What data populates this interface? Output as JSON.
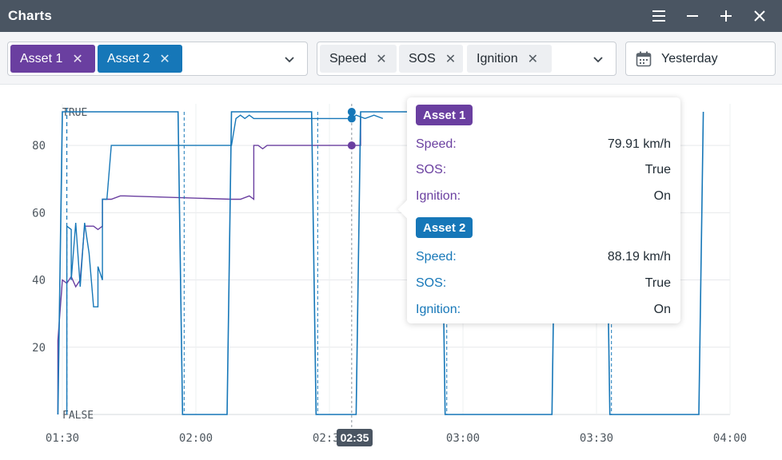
{
  "window": {
    "title": "Charts"
  },
  "toolbar": {
    "assets": [
      {
        "label": "Asset 1",
        "color": "#6a3fa0"
      },
      {
        "label": "Asset 2",
        "color": "#1677b8"
      }
    ],
    "metrics": [
      {
        "label": "Speed"
      },
      {
        "label": "SOS"
      },
      {
        "label": "Ignition"
      }
    ],
    "date_range": "Yesterday"
  },
  "chart_data": {
    "type": "line",
    "x_ticks": [
      "01:30",
      "02:00",
      "02:30",
      "03:00",
      "03:30",
      "04:00"
    ],
    "y_ticks": [
      "20",
      "40",
      "60",
      "80"
    ],
    "boolean_labels": {
      "true": "TRUE",
      "false": "FALSE"
    },
    "cursor_time": "02:35",
    "ylim": [
      0,
      90
    ],
    "grid": true,
    "series": [
      {
        "name": "Asset 1",
        "color": "#6a3fa0",
        "speed": [
          [
            "01:29",
            0
          ],
          [
            "01:29",
            22
          ],
          [
            "01:30",
            40
          ],
          [
            "01:31",
            39
          ],
          [
            "01:32",
            41
          ],
          [
            "01:33",
            38
          ],
          [
            "01:34",
            40
          ],
          [
            "01:35",
            56
          ],
          [
            "01:37",
            56
          ],
          [
            "01:38",
            55
          ],
          [
            "01:39",
            56
          ],
          [
            "01:39",
            64
          ],
          [
            "01:41",
            64
          ],
          [
            "01:43",
            65
          ],
          [
            "01:44",
            65
          ],
          [
            "02:08",
            64
          ],
          [
            "02:10",
            64
          ],
          [
            "02:12",
            65
          ],
          [
            "02:13",
            64
          ],
          [
            "02:13",
            80
          ],
          [
            "02:14",
            80
          ],
          [
            "02:15",
            79
          ],
          [
            "02:16",
            80
          ],
          [
            "02:35",
            80
          ],
          [
            "02:37",
            80
          ],
          [
            "02:37",
            88
          ]
        ]
      },
      {
        "name": "Asset 2",
        "color": "#1677b8",
        "speed": [
          [
            "01:31",
            0
          ],
          [
            "01:31",
            56
          ],
          [
            "01:32",
            55
          ],
          [
            "01:32",
            40
          ],
          [
            "01:33",
            57
          ],
          [
            "01:34",
            38
          ],
          [
            "01:35",
            57
          ],
          [
            "01:36",
            48
          ],
          [
            "01:37",
            32
          ],
          [
            "01:38",
            32
          ],
          [
            "01:38",
            44
          ],
          [
            "01:39",
            40
          ],
          [
            "01:39",
            64
          ],
          [
            "01:40",
            64
          ],
          [
            "01:41",
            80
          ],
          [
            "01:42",
            80
          ],
          [
            "01:43",
            80
          ],
          [
            "01:44",
            80
          ],
          [
            "02:08",
            80
          ],
          [
            "02:09",
            88
          ],
          [
            "02:10",
            89
          ],
          [
            "02:11",
            88
          ],
          [
            "02:12",
            89
          ],
          [
            "02:13",
            88
          ],
          [
            "02:35",
            88
          ],
          [
            "02:36",
            89
          ],
          [
            "02:38",
            88
          ],
          [
            "02:40",
            89
          ],
          [
            "02:42",
            88
          ]
        ],
        "ignition": [
          [
            "01:29",
            0
          ],
          [
            "01:30",
            1
          ],
          [
            "01:56",
            1
          ],
          [
            "01:57",
            0
          ],
          [
            "02:07",
            0
          ],
          [
            "02:08",
            1
          ],
          [
            "02:26",
            1
          ],
          [
            "02:27",
            0
          ],
          [
            "02:36",
            0
          ],
          [
            "02:37",
            1
          ],
          [
            "02:55",
            1
          ],
          [
            "02:56",
            0
          ],
          [
            "03:20",
            0
          ],
          [
            "03:21",
            1
          ],
          [
            "03:32",
            1
          ],
          [
            "03:33",
            0
          ],
          [
            "03:53",
            0
          ],
          [
            "03:54",
            1
          ]
        ]
      }
    ]
  },
  "tooltip": {
    "groups": [
      {
        "asset": "Asset 1",
        "color": "#6a3fa0",
        "rows": [
          {
            "label": "Speed:",
            "value": "79.91 km/h"
          },
          {
            "label": "SOS:",
            "value": "True"
          },
          {
            "label": "Ignition:",
            "value": "On"
          }
        ]
      },
      {
        "asset": "Asset 2",
        "color": "#1677b8",
        "rows": [
          {
            "label": "Speed:",
            "value": "88.19 km/h"
          },
          {
            "label": "SOS:",
            "value": "True"
          },
          {
            "label": "Ignition:",
            "value": "On"
          }
        ]
      }
    ]
  }
}
